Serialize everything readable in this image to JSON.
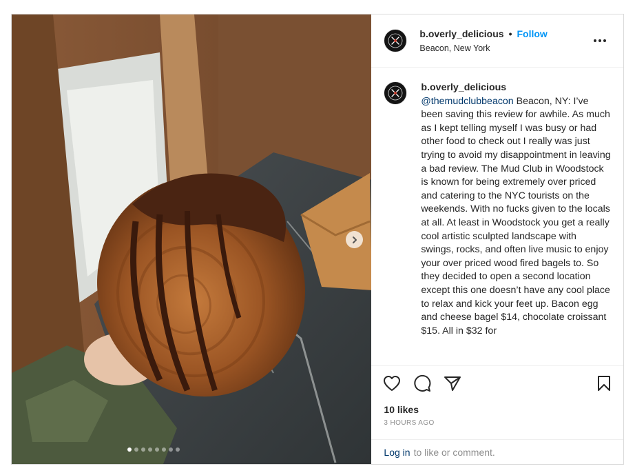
{
  "post": {
    "username": "b.overly_delicious",
    "separator": "•",
    "follow_label": "Follow",
    "location": "Beacon, New York",
    "caption": {
      "username": "b.overly_delicious",
      "mention": "@themudclubbeacon",
      "text": " Beacon, NY: I’ve been saving this review for awhile. As much as I kept telling myself I was busy or had other food to check out I really was just trying to avoid my disappointment in leaving a bad review. The Mud Club in Woodstock is known for being extremely over priced and catering to the NYC tourists on the weekends. With no fucks given to the locals at all. At least in Woodstock you get a really cool artistic sculpted landscape with swings, rocks, and often live music to enjoy your over priced wood fired bagels to. So they decided to open a second location except this one doesn’t have any cool place to relax and kick your feet up. Bacon egg and cheese bagel $14, chocolate croissant $15. All in $32 for"
    },
    "likes": "10 likes",
    "time": "3 HOURS AGO",
    "login": {
      "link": "Log in",
      "text": "to like or comment."
    },
    "carousel": {
      "slide_count": 8,
      "active_index": 0
    },
    "icons": {
      "more": "more-options-icon",
      "like": "heart-icon",
      "comment": "comment-icon",
      "share": "share-icon",
      "save": "bookmark-icon",
      "next": "chevron-right-icon"
    },
    "colors": {
      "follow": "#0095f6",
      "link": "#00376b",
      "muted": "#8e8e8e"
    }
  }
}
